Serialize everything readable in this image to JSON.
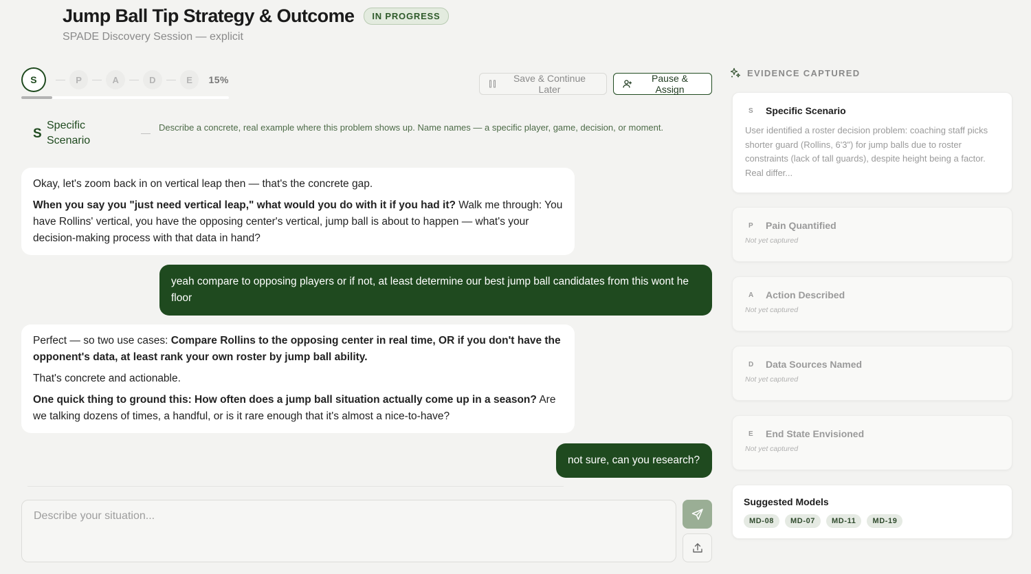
{
  "header": {
    "title": "Jump Ball Tip Strategy & Outcome",
    "status": "IN PROGRESS",
    "subtitle": "SPADE Discovery Session — explicit"
  },
  "stepper": {
    "steps": [
      "S",
      "P",
      "A",
      "D",
      "E"
    ],
    "active_index": 0,
    "progress_label": "15%",
    "progress_fraction": 0.15
  },
  "actions": {
    "save_label": "Save & Continue Later",
    "pause_label": "Pause & Assign"
  },
  "current_step": {
    "letter": "S",
    "name": "Specific Scenario",
    "separator": "—",
    "description": "Describe a concrete, real example where this problem shows up. Name names — a specific player, game, decision, or moment."
  },
  "messages": [
    {
      "role": "assistant",
      "p1": "Okay, let's zoom back in on vertical leap then — that's the concrete gap.",
      "p2_bold": "When you say you \"just need vertical leap,\" what would you do with it if you had it?",
      "p2_rest": " Walk me through: You have Rollins' vertical, you have the opposing center's vertical, jump ball is about to happen — what's your decision-making process with that data in hand?"
    },
    {
      "role": "user",
      "text": "yeah compare to opposing players or if not, at least determine our best jump ball candidates from this wont he floor"
    },
    {
      "role": "assistant",
      "p1_lead": "Perfect — so two use cases: ",
      "p1_bold": "Compare Rollins to the opposing center in real time, OR if you don't have the opponent's data, at least rank your own roster by jump ball ability.",
      "p2": "That's concrete and actionable.",
      "p3_bold": "One quick thing to ground this: How often does a jump ball situation actually come up in a season?",
      "p3_rest": " Are we talking dozens of times, a handful, or is it rare enough that it's almost a nice-to-have?"
    },
    {
      "role": "user",
      "text": "not sure, can you research?"
    }
  ],
  "composer": {
    "placeholder": "Describe your situation..."
  },
  "evidence": {
    "title": "EVIDENCE CAPTURED",
    "cards": [
      {
        "letter": "S",
        "title": "Specific Scenario",
        "body": "User identified a roster decision problem: coaching staff picks shorter guard (Rollins, 6'3\") for jump balls due to roster constraints (lack of tall guards), despite height being a factor. Real differ..."
      },
      {
        "letter": "P",
        "title": "Pain Quantified",
        "empty_note": "Not yet captured"
      },
      {
        "letter": "A",
        "title": "Action Described",
        "empty_note": "Not yet captured"
      },
      {
        "letter": "D",
        "title": "Data Sources Named",
        "empty_note": "Not yet captured"
      },
      {
        "letter": "E",
        "title": "End State Envisioned",
        "empty_note": "Not yet captured"
      }
    ],
    "models": {
      "title": "Suggested Models",
      "chips": [
        "MD-08",
        "MD-07",
        "MD-11",
        "MD-19"
      ]
    }
  },
  "colors": {
    "brand_green": "#1f4a1f",
    "badge_bg": "#e3ebdf",
    "page_bg": "#f3f3f1"
  },
  "icons": {
    "save": "pause-bars-icon",
    "pause": "user-plus-icon",
    "send": "paper-plane-icon",
    "upload": "upload-icon",
    "evidence": "sparkles-icon"
  }
}
